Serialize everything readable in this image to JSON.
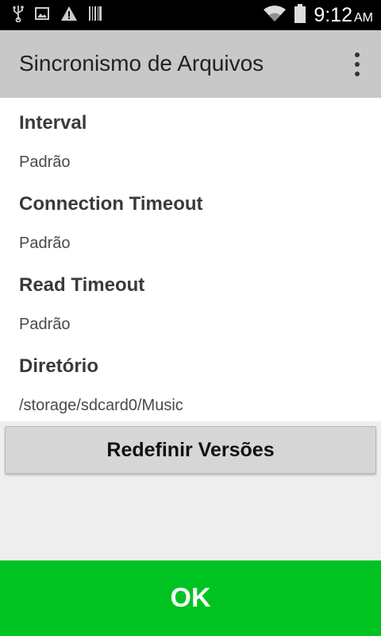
{
  "status_bar": {
    "time": "9:12",
    "ampm": "AM",
    "icons": [
      "usb-icon",
      "image-icon",
      "warning-icon",
      "barcode-icon",
      "wifi-icon",
      "battery-icon"
    ]
  },
  "app_bar": {
    "title": "Sincronismo de Arquivos",
    "overflow_icon": "more-vert-icon"
  },
  "preferences": [
    {
      "title": "Interval",
      "summary": "Padrão"
    },
    {
      "title": "Connection Timeout",
      "summary": "Padrão"
    },
    {
      "title": "Read Timeout",
      "summary": "Padrão"
    },
    {
      "title": "Diretório",
      "summary": "/storage/sdcard0/Music"
    }
  ],
  "buttons": {
    "reset_label": "Redefinir Versões",
    "ok_label": "OK"
  },
  "colors": {
    "status_bar": "#000000",
    "app_bar": "#c8c8c8",
    "ok_button": "#00c322",
    "reset_button": "#d6d6d6",
    "background": "#eeeeee"
  }
}
